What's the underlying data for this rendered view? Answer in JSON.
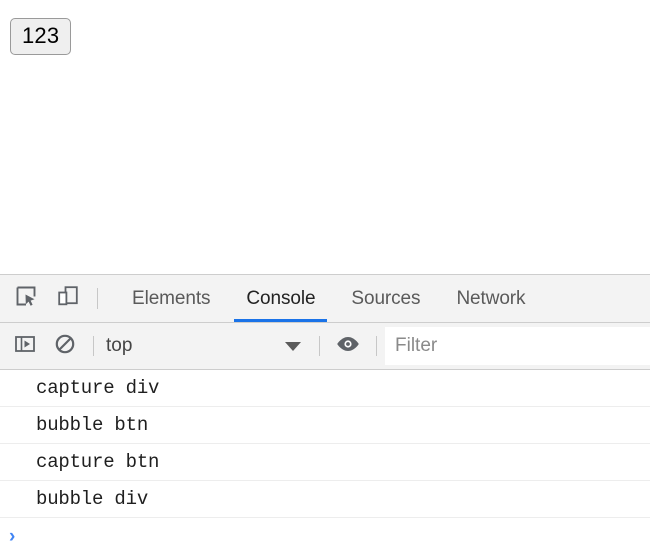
{
  "page": {
    "button": {
      "label": "123",
      "name": "number-button"
    },
    "background_color": "#ffffff"
  },
  "devtools": {
    "toolbar": {
      "inspect_icon": "inspect-element-icon",
      "device_icon": "device-toolbar-icon"
    },
    "tabs": [
      {
        "label": "Elements",
        "active": false
      },
      {
        "label": "Console",
        "active": true
      },
      {
        "label": "Sources",
        "active": false
      },
      {
        "label": "Network",
        "active": false
      }
    ],
    "active_tab_color": "#1a73e8",
    "console_toolbar": {
      "sidebar_icon": "console-sidebar-toggle-icon",
      "clear_icon": "clear-console-icon",
      "context": "top",
      "context_caret": "chevron-down-icon",
      "eye_icon": "live-expression-eye-icon",
      "filter_placeholder": "Filter",
      "filter_value": ""
    },
    "console_messages": [
      {
        "text": "capture div"
      },
      {
        "text": "bubble btn"
      },
      {
        "text": "capture btn"
      },
      {
        "text": "bubble div"
      }
    ],
    "prompt": {
      "chevron": "›",
      "value": "",
      "chevron_color": "#4285f4"
    }
  }
}
